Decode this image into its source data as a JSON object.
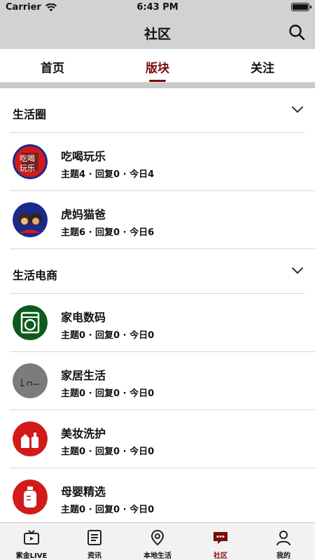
{
  "status": {
    "carrier": "Carrier",
    "time": "6:43 PM"
  },
  "nav": {
    "title": "社区",
    "search_icon": "search-icon"
  },
  "tabs": [
    {
      "label": "首页",
      "active": false
    },
    {
      "label": "版块",
      "active": true
    },
    {
      "label": "关注",
      "active": false
    }
  ],
  "sections": [
    {
      "title": "生活圈",
      "items": [
        {
          "title": "吃喝玩乐",
          "meta": "主题4 · 回复0 · 今日4",
          "icon": "food-fun-icon"
        },
        {
          "title": "虎妈猫爸",
          "meta": "主题6 · 回复0 · 今日6",
          "icon": "parents-icon"
        }
      ]
    },
    {
      "title": "生活电商",
      "items": [
        {
          "title": "家电数码",
          "meta": "主题0 · 回复0 · 今日0",
          "icon": "washing-machine-icon"
        },
        {
          "title": "家居生活",
          "meta": "主题0 · 回复0 · 今日0",
          "icon": "home-living-icon"
        },
        {
          "title": "美妆洗护",
          "meta": "主题0 · 回复0 · 今日0",
          "icon": "cosmetics-icon"
        },
        {
          "title": "母婴精选",
          "meta": "主题0 · 回复0 · 今日0",
          "icon": "baby-bottle-icon"
        }
      ]
    }
  ],
  "tabbar": [
    {
      "label": "紫金LIVE",
      "icon": "tv-icon",
      "active": false
    },
    {
      "label": "资讯",
      "icon": "news-icon",
      "active": false
    },
    {
      "label": "本地生活",
      "icon": "location-icon",
      "active": false
    },
    {
      "label": "社区",
      "icon": "chat-icon",
      "active": true
    },
    {
      "label": "我的",
      "icon": "profile-icon",
      "active": false
    }
  ],
  "colors": {
    "accent": "#7a0c0c",
    "nav_bg": "#d2d2d2"
  }
}
